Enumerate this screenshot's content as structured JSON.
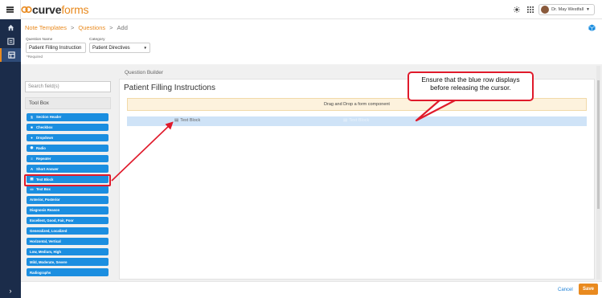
{
  "brand": {
    "name_part1": "curve",
    "name_part2": "forms"
  },
  "header": {
    "user_name": "Dr. May Westfall"
  },
  "breadcrumb": {
    "item1": "Note Templates",
    "sep1": ">",
    "item2": "Questions",
    "sep2": ">",
    "current": "Add"
  },
  "form": {
    "question_name_label": "Question Name",
    "question_name_value": "Patient Filling Instruction",
    "category_label": "Category",
    "category_value": "Patient Directives",
    "required_note": "*Required"
  },
  "toolbox": {
    "search_placeholder": "Search field(s)",
    "title": "Tool Box",
    "items": [
      {
        "label": "Section Header",
        "icon": "§"
      },
      {
        "label": "Checkbox",
        "icon": "■"
      },
      {
        "label": "Dropdown",
        "icon": "●"
      },
      {
        "label": "Radio",
        "icon": "◉"
      },
      {
        "label": "Repeater",
        "icon": "≡"
      },
      {
        "label": "Short Answer",
        "icon": "A"
      },
      {
        "label": "Text Block",
        "icon": "▤"
      },
      {
        "label": "Text Box",
        "icon": "▭"
      },
      {
        "label": "Anterior, Posterior",
        "icon": ""
      },
      {
        "label": "Diagnosis Reason",
        "icon": ""
      },
      {
        "label": "Excellent, Good, Fair, Poor",
        "icon": ""
      },
      {
        "label": "Generalized, Localized",
        "icon": ""
      },
      {
        "label": "Horizontal, Vertical",
        "icon": ""
      },
      {
        "label": "Low, Medium, High",
        "icon": ""
      },
      {
        "label": "Mild, Moderate, Severe",
        "icon": ""
      },
      {
        "label": "Radiographs",
        "icon": ""
      }
    ]
  },
  "builder": {
    "section_label": "Question Builder",
    "title": "Patient Filling Instructions",
    "dropzone_text": "Drag and Drop a form component",
    "drag_item": "Text Block",
    "ghost_item": "Text Block"
  },
  "callout": {
    "line1": "Ensure that the blue row displays",
    "line2": "before releasing the cursor."
  },
  "footer": {
    "cancel": "Cancel",
    "save": "Save"
  },
  "colors": {
    "rail": "#1b2c4a",
    "accent": "#e98a1f",
    "tool": "#1b8ee0",
    "highlight": "#e01a2b"
  }
}
